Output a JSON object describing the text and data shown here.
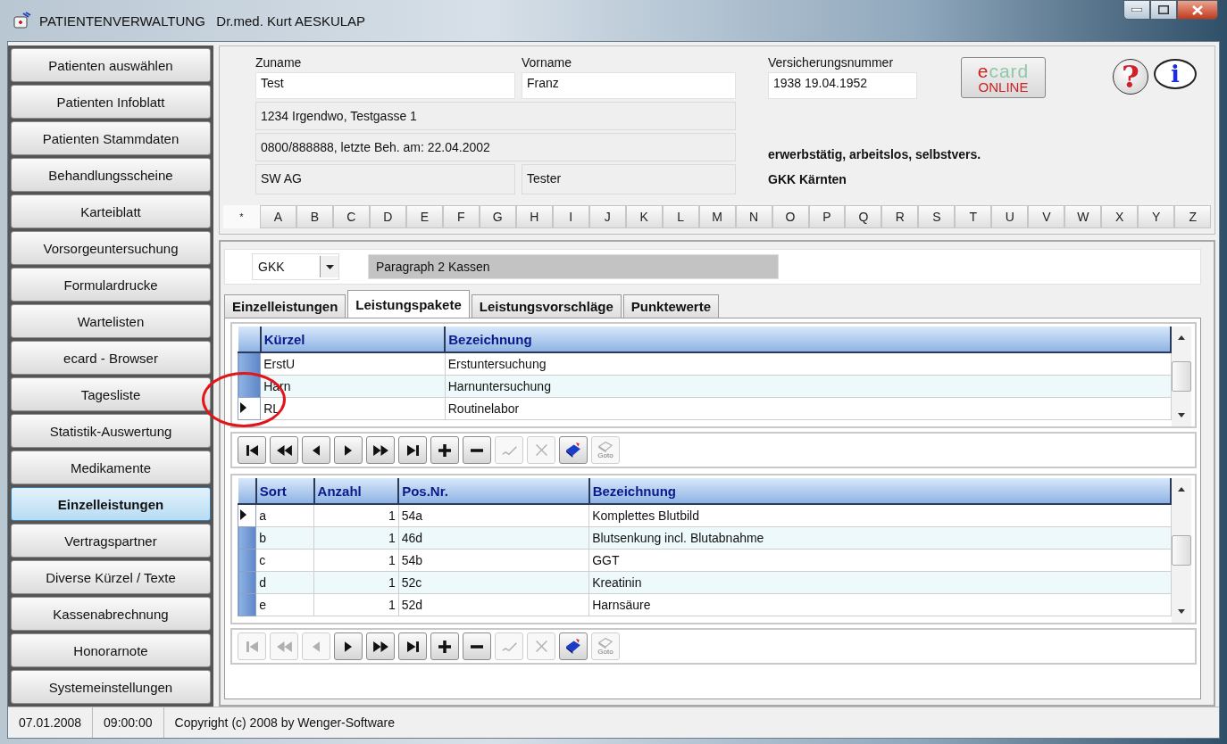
{
  "window": {
    "title": "PATIENTENVERWALTUNG   Dr.med. Kurt AESKULAP"
  },
  "sidebar": {
    "items": [
      {
        "label": "Patienten auswählen",
        "selected": false
      },
      {
        "label": "Patienten Infoblatt",
        "selected": false
      },
      {
        "label": "Patienten Stammdaten",
        "selected": false
      },
      {
        "label": "Behandlungsscheine",
        "selected": false
      },
      {
        "label": "Karteiblatt",
        "selected": false
      },
      {
        "label": "Vorsorgeuntersuchung",
        "selected": false
      },
      {
        "label": "Formulardrucke",
        "selected": false
      },
      {
        "label": "Wartelisten",
        "selected": false
      },
      {
        "label": "ecard - Browser",
        "selected": false
      },
      {
        "label": "Tagesliste",
        "selected": false
      },
      {
        "label": "Statistik-Auswertung",
        "selected": false
      },
      {
        "label": "Medikamente",
        "selected": false
      },
      {
        "label": "Einzelleistungen",
        "selected": true
      },
      {
        "label": "Vertragspartner",
        "selected": false
      },
      {
        "label": "Diverse Kürzel / Texte",
        "selected": false
      },
      {
        "label": "Kassenabrechnung",
        "selected": false
      },
      {
        "label": "Honorarnote",
        "selected": false
      },
      {
        "label": "Systemeinstellungen",
        "selected": false
      }
    ]
  },
  "patient": {
    "surname": {
      "label": "Zuname",
      "value": "Test"
    },
    "first_name": {
      "label": "Vorname",
      "value": "Franz"
    },
    "insurance_number": {
      "label": "Versicherungsnummer",
      "value": "1938  19.04.1952"
    },
    "address": "1234  Irgendwo,  Testgasse 1",
    "contact": "0800/888888,   letzte Beh. am: 22.04.2002",
    "employer": "SW AG",
    "occupation": "Tester",
    "employment_status": "erwerbstätig, arbeitslos, selbstvers.",
    "insurer": "GKK Kärnten"
  },
  "ecard_button": {
    "brand": "ecard",
    "status": "ONLINE"
  },
  "help_button": {
    "glyph": "?"
  },
  "info_button": {
    "glyph": "i"
  },
  "alphabet": [
    {
      "label": "*",
      "selected": true
    },
    {
      "label": "A",
      "selected": false
    },
    {
      "label": "B",
      "selected": false
    },
    {
      "label": "C",
      "selected": false
    },
    {
      "label": "D",
      "selected": false
    },
    {
      "label": "E",
      "selected": false
    },
    {
      "label": "F",
      "selected": false
    },
    {
      "label": "G",
      "selected": false
    },
    {
      "label": "H",
      "selected": false
    },
    {
      "label": "I",
      "selected": false
    },
    {
      "label": "J",
      "selected": false
    },
    {
      "label": "K",
      "selected": false
    },
    {
      "label": "L",
      "selected": false
    },
    {
      "label": "M",
      "selected": false
    },
    {
      "label": "N",
      "selected": false
    },
    {
      "label": "O",
      "selected": false
    },
    {
      "label": "P",
      "selected": false
    },
    {
      "label": "Q",
      "selected": false
    },
    {
      "label": "R",
      "selected": false
    },
    {
      "label": "S",
      "selected": false
    },
    {
      "label": "T",
      "selected": false
    },
    {
      "label": "U",
      "selected": false
    },
    {
      "label": "V",
      "selected": false
    },
    {
      "label": "W",
      "selected": false
    },
    {
      "label": "X",
      "selected": false
    },
    {
      "label": "Y",
      "selected": false
    },
    {
      "label": "Z",
      "selected": false
    }
  ],
  "insurance_select": {
    "value": "GKK",
    "name": "Paragraph 2 Kassen"
  },
  "tabs": [
    {
      "label": "Einzelleistungen",
      "selected": false
    },
    {
      "label": "Leistungspakete",
      "selected": true
    },
    {
      "label": "Leistungsvorschläge",
      "selected": false
    },
    {
      "label": "Punktewerte",
      "selected": false
    }
  ],
  "packages_table": {
    "columns": [
      "Kürzel",
      "Bezeichnung"
    ],
    "rows": [
      {
        "cells": [
          "ErstU",
          "Erstuntersuchung"
        ],
        "selected": false
      },
      {
        "cells": [
          "Harn",
          "Harnuntersuchung"
        ],
        "selected": false
      },
      {
        "cells": [
          "RL",
          "Routinelabor"
        ],
        "selected": true
      }
    ]
  },
  "packages_toolbar": {
    "buttons": [
      {
        "kind": "first",
        "disabled": false
      },
      {
        "kind": "prev_page",
        "disabled": false
      },
      {
        "kind": "prev",
        "disabled": false
      },
      {
        "kind": "next",
        "disabled": false
      },
      {
        "kind": "next_page",
        "disabled": false
      },
      {
        "kind": "last",
        "disabled": false
      },
      {
        "kind": "add",
        "disabled": false
      },
      {
        "kind": "remove",
        "disabled": false
      },
      {
        "kind": "confirm",
        "disabled": true
      },
      {
        "kind": "cancel",
        "disabled": true
      },
      {
        "kind": "edit",
        "disabled": false
      },
      {
        "kind": "goto",
        "disabled": true,
        "label": "Goto"
      }
    ]
  },
  "items_table": {
    "columns": [
      "Sort",
      "Anzahl",
      "Pos.Nr.",
      "Bezeichnung"
    ],
    "rows": [
      {
        "cells": [
          "a",
          "1",
          "54a",
          "Komplettes Blutbild"
        ],
        "selected": true
      },
      {
        "cells": [
          "b",
          "1",
          "46d",
          "Blutsenkung incl. Blutabnahme"
        ],
        "selected": false
      },
      {
        "cells": [
          "c",
          "1",
          "54b",
          "GGT"
        ],
        "selected": false
      },
      {
        "cells": [
          "d",
          "1",
          "52c",
          "Kreatinin"
        ],
        "selected": false
      },
      {
        "cells": [
          "e",
          "1",
          "52d",
          "Harnsäure"
        ],
        "selected": false
      }
    ]
  },
  "items_toolbar": {
    "buttons": [
      {
        "kind": "first",
        "disabled": true
      },
      {
        "kind": "prev_page",
        "disabled": true
      },
      {
        "kind": "prev",
        "disabled": true
      },
      {
        "kind": "next",
        "disabled": false
      },
      {
        "kind": "next_page",
        "disabled": false
      },
      {
        "kind": "last",
        "disabled": false
      },
      {
        "kind": "add",
        "disabled": false
      },
      {
        "kind": "remove",
        "disabled": false
      },
      {
        "kind": "confirm",
        "disabled": true
      },
      {
        "kind": "cancel",
        "disabled": true
      },
      {
        "kind": "edit",
        "disabled": false
      },
      {
        "kind": "goto",
        "disabled": true,
        "label": "Goto"
      }
    ]
  },
  "status_bar": {
    "date": "07.01.2008",
    "time": "09:00:00",
    "text": "Copyright (c) 2008 by Wenger-Software"
  }
}
